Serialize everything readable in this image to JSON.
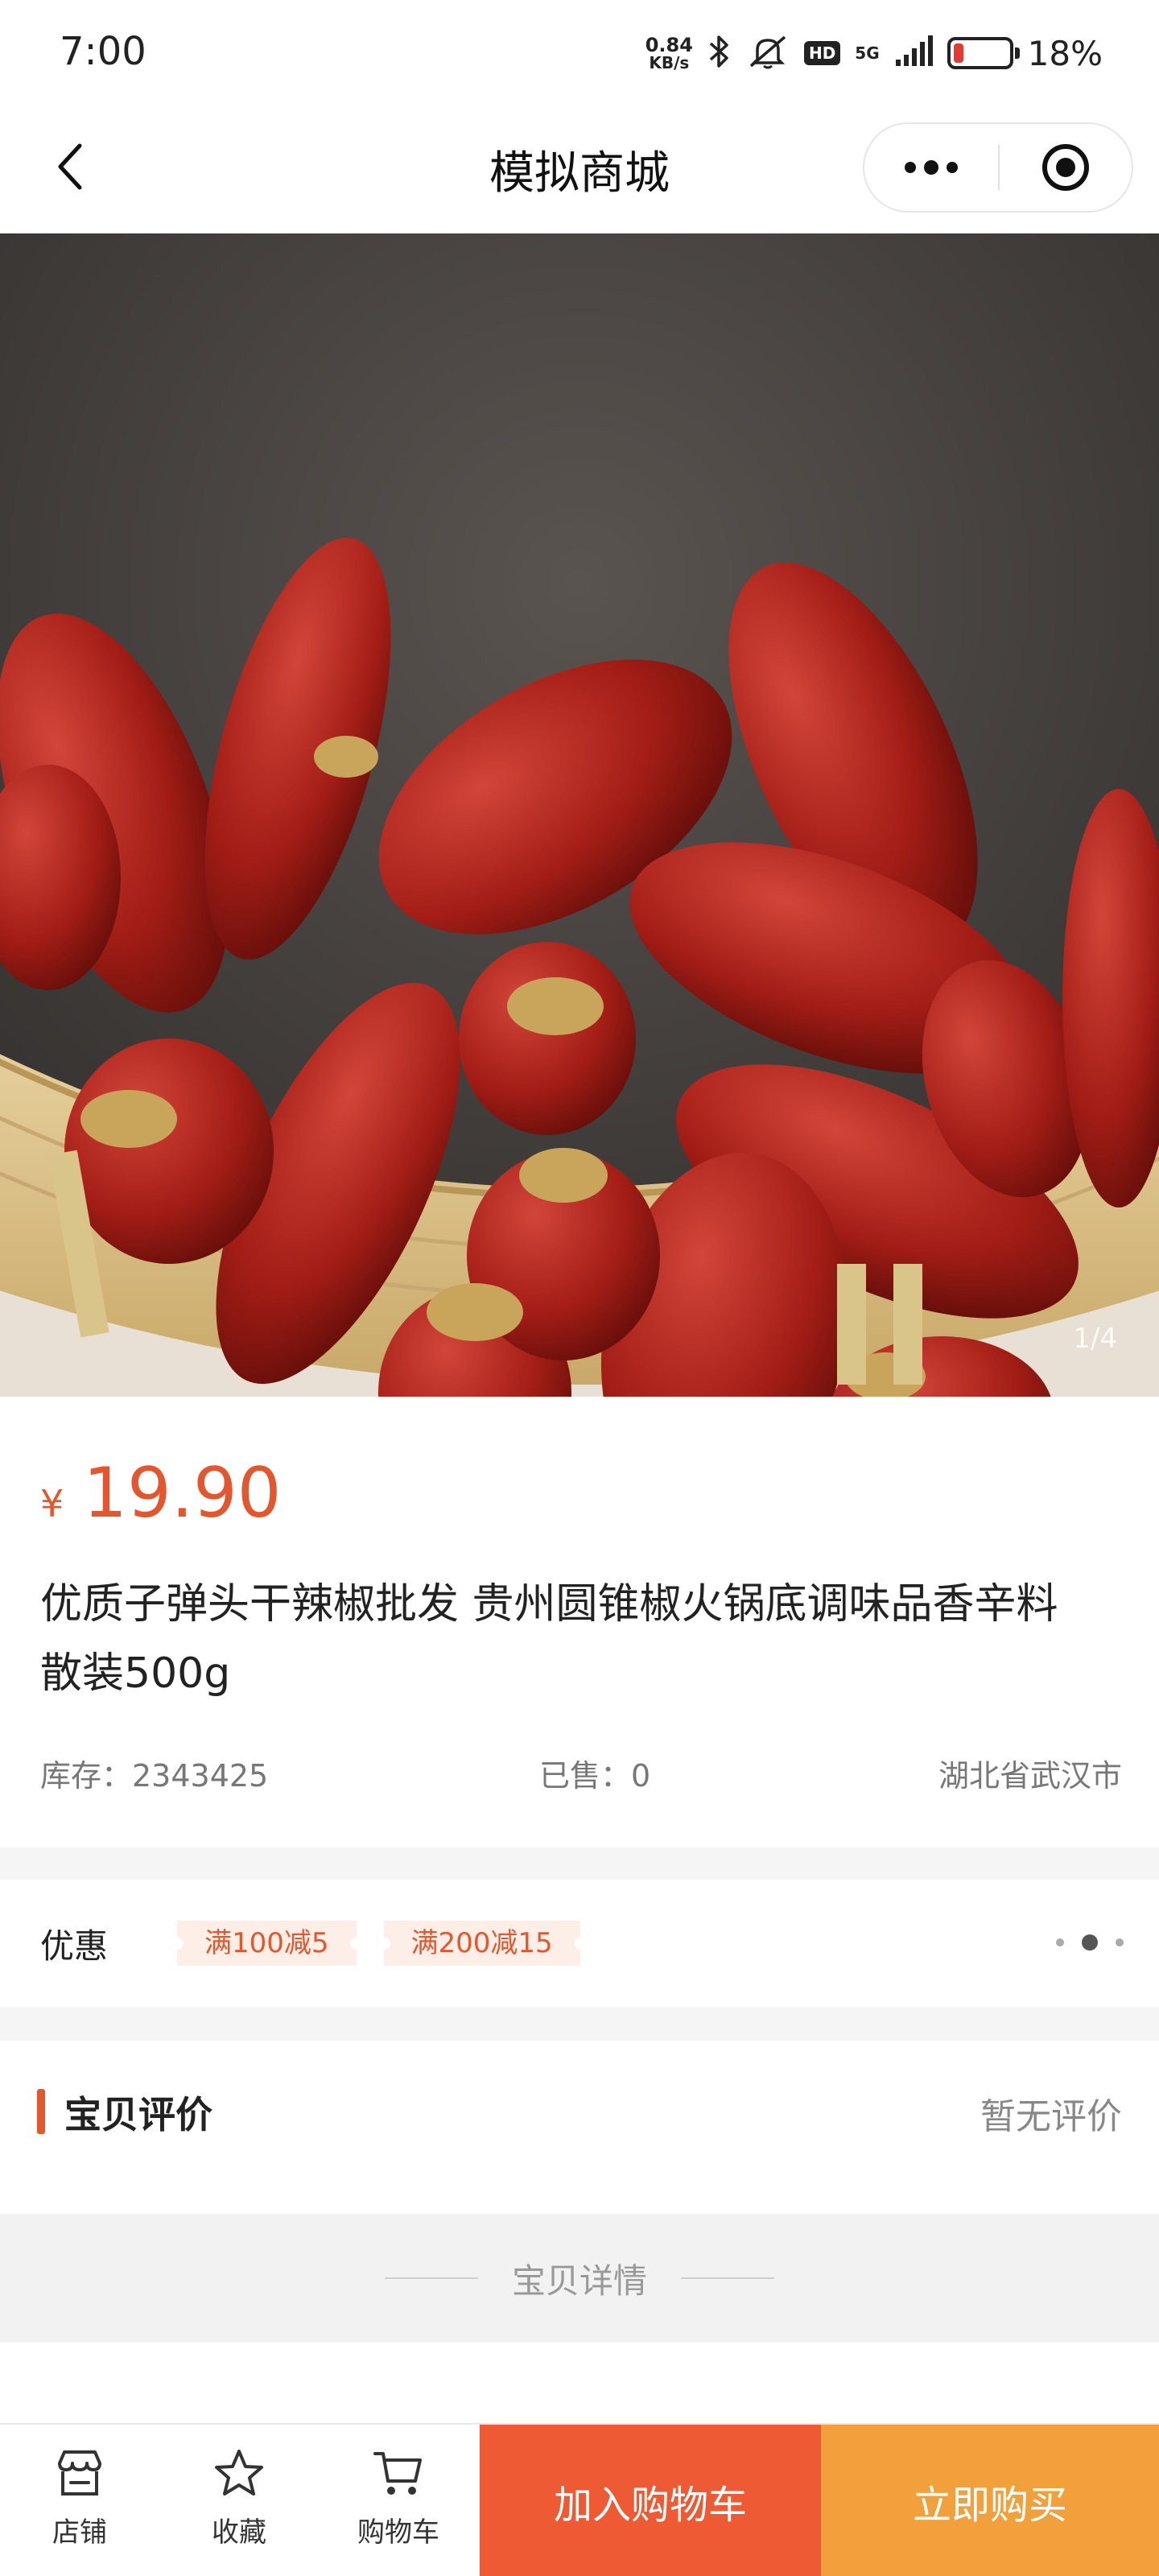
{
  "status_bar": {
    "time": "7:00",
    "net_speed_value": "0.84",
    "net_speed_unit": "KB/s",
    "hd": "HD",
    "network": "5G",
    "battery_percent": "18%",
    "battery_level": 0.18
  },
  "nav": {
    "title": "模拟商城",
    "icons": [
      "back-arrow-icon",
      "more-dots-icon",
      "close-target-icon"
    ]
  },
  "gallery": {
    "counter": "1/4"
  },
  "product": {
    "currency": "¥",
    "price": "19.90",
    "title": "优质子弹头干辣椒批发 贵州圆锥椒火锅底调味品香辛料散装500g",
    "stock": "库存：2343425",
    "sold": "已售：0",
    "location": "湖北省武汉市"
  },
  "promo": {
    "label": "优惠",
    "coupons": [
      "满100减5",
      "满200减15"
    ]
  },
  "reviews": {
    "title": "宝贝评价",
    "empty": "暂无评价"
  },
  "detail": {
    "heading": "宝贝详情"
  },
  "toolbar": {
    "shop": "店铺",
    "favorite": "收藏",
    "cart": "购物车",
    "add_to_cart": "加入购物车",
    "buy_now": "立即购买"
  },
  "colors": {
    "accent": "#e4572e",
    "cart_button": "#ee5a34",
    "buy_button": "#f2a03b"
  }
}
